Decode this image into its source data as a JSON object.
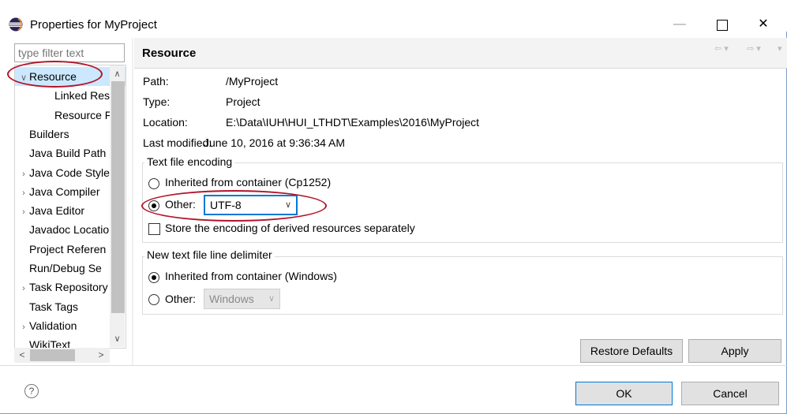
{
  "window": {
    "title": "Properties for MyProject"
  },
  "filter": {
    "placeholder": "type filter text"
  },
  "tree": [
    {
      "label": "Resource",
      "arrow": "v",
      "indent": 0,
      "selected": true
    },
    {
      "label": "Linked Resou",
      "arrow": "",
      "indent": 2
    },
    {
      "label": "Resource Filt",
      "arrow": "",
      "indent": 2
    },
    {
      "label": "Builders",
      "arrow": "",
      "indent": 0
    },
    {
      "label": "Java Build Path",
      "arrow": "",
      "indent": 0
    },
    {
      "label": "Java Code Style",
      "arrow": ">",
      "indent": 0
    },
    {
      "label": "Java Compiler",
      "arrow": ">",
      "indent": 0
    },
    {
      "label": "Java Editor",
      "arrow": ">",
      "indent": 0
    },
    {
      "label": "Javadoc Locatio",
      "arrow": "",
      "indent": 0
    },
    {
      "label": "Project Referen",
      "arrow": "",
      "indent": 0
    },
    {
      "label": "Run/Debug Se",
      "arrow": "",
      "indent": 0
    },
    {
      "label": "Task Repository",
      "arrow": ">",
      "indent": 0
    },
    {
      "label": "Task Tags",
      "arrow": "",
      "indent": 0
    },
    {
      "label": "Validation",
      "arrow": ">",
      "indent": 0
    },
    {
      "label": "WikiText",
      "arrow": "",
      "indent": 0
    }
  ],
  "page": {
    "title": "Resource",
    "path_label": "Path:",
    "path_value": "/MyProject",
    "type_label": "Type:",
    "type_value": "Project",
    "location_label": "Location:",
    "location_value": "E:\\Data\\IUH\\HUI_LTHDT\\Examples\\2016\\MyProject",
    "modified_label": "Last modified:",
    "modified_value": "June 10, 2016 at 9:36:34 AM"
  },
  "encoding": {
    "group_title": "Text file encoding",
    "inherited_label": "Inherited from container (Cp1252)",
    "other_label": "Other:",
    "other_value": "UTF-8",
    "derived_label": "Store the encoding of derived resources separately"
  },
  "delimiter": {
    "group_title": "New text file line delimiter",
    "inherited_label": "Inherited from container (Windows)",
    "other_label": "Other:",
    "other_value": "Windows"
  },
  "buttons": {
    "restore": "Restore Defaults",
    "apply": "Apply",
    "ok": "OK",
    "cancel": "Cancel"
  },
  "colors": {
    "annotation": "#b2142a",
    "selection": "#cce8ff",
    "focus": "#0078d7"
  },
  "icons": [
    "eclipse-icon",
    "minimize-icon",
    "maximize-icon",
    "close-icon",
    "back-icon",
    "forward-icon",
    "help-icon"
  ]
}
